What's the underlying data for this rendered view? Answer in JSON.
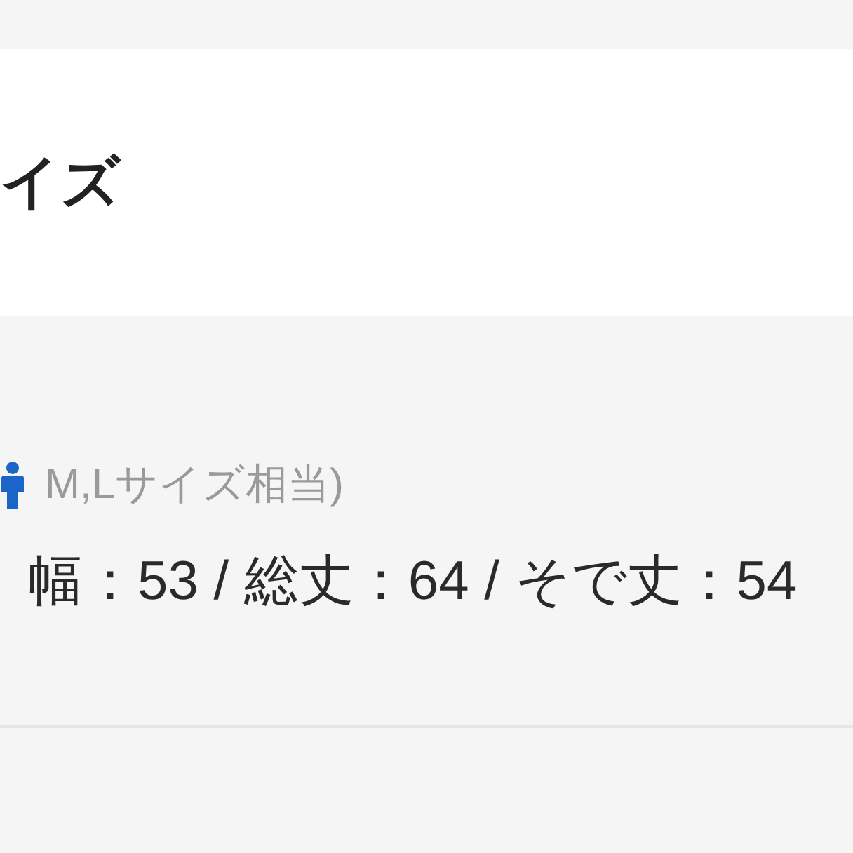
{
  "header": {
    "title": "イズ"
  },
  "size_info": {
    "note": "M,Lサイズ相当)",
    "measurements": "幅：53 / 総丈：64 / そで丈：54"
  }
}
